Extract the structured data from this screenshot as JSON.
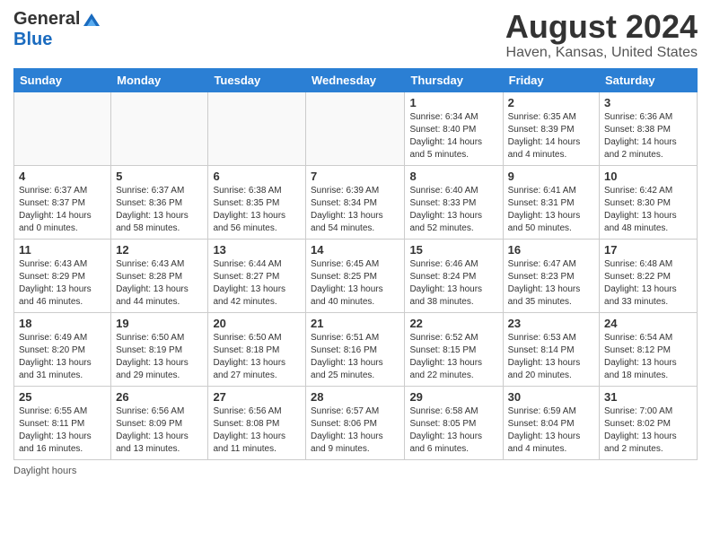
{
  "header": {
    "logo_general": "General",
    "logo_blue": "Blue",
    "month_title": "August 2024",
    "location": "Haven, Kansas, United States"
  },
  "days_of_week": [
    "Sunday",
    "Monday",
    "Tuesday",
    "Wednesday",
    "Thursday",
    "Friday",
    "Saturday"
  ],
  "weeks": [
    [
      {
        "day": "",
        "info": ""
      },
      {
        "day": "",
        "info": ""
      },
      {
        "day": "",
        "info": ""
      },
      {
        "day": "",
        "info": ""
      },
      {
        "day": "1",
        "info": "Sunrise: 6:34 AM\nSunset: 8:40 PM\nDaylight: 14 hours\nand 5 minutes."
      },
      {
        "day": "2",
        "info": "Sunrise: 6:35 AM\nSunset: 8:39 PM\nDaylight: 14 hours\nand 4 minutes."
      },
      {
        "day": "3",
        "info": "Sunrise: 6:36 AM\nSunset: 8:38 PM\nDaylight: 14 hours\nand 2 minutes."
      }
    ],
    [
      {
        "day": "4",
        "info": "Sunrise: 6:37 AM\nSunset: 8:37 PM\nDaylight: 14 hours\nand 0 minutes."
      },
      {
        "day": "5",
        "info": "Sunrise: 6:37 AM\nSunset: 8:36 PM\nDaylight: 13 hours\nand 58 minutes."
      },
      {
        "day": "6",
        "info": "Sunrise: 6:38 AM\nSunset: 8:35 PM\nDaylight: 13 hours\nand 56 minutes."
      },
      {
        "day": "7",
        "info": "Sunrise: 6:39 AM\nSunset: 8:34 PM\nDaylight: 13 hours\nand 54 minutes."
      },
      {
        "day": "8",
        "info": "Sunrise: 6:40 AM\nSunset: 8:33 PM\nDaylight: 13 hours\nand 52 minutes."
      },
      {
        "day": "9",
        "info": "Sunrise: 6:41 AM\nSunset: 8:31 PM\nDaylight: 13 hours\nand 50 minutes."
      },
      {
        "day": "10",
        "info": "Sunrise: 6:42 AM\nSunset: 8:30 PM\nDaylight: 13 hours\nand 48 minutes."
      }
    ],
    [
      {
        "day": "11",
        "info": "Sunrise: 6:43 AM\nSunset: 8:29 PM\nDaylight: 13 hours\nand 46 minutes."
      },
      {
        "day": "12",
        "info": "Sunrise: 6:43 AM\nSunset: 8:28 PM\nDaylight: 13 hours\nand 44 minutes."
      },
      {
        "day": "13",
        "info": "Sunrise: 6:44 AM\nSunset: 8:27 PM\nDaylight: 13 hours\nand 42 minutes."
      },
      {
        "day": "14",
        "info": "Sunrise: 6:45 AM\nSunset: 8:25 PM\nDaylight: 13 hours\nand 40 minutes."
      },
      {
        "day": "15",
        "info": "Sunrise: 6:46 AM\nSunset: 8:24 PM\nDaylight: 13 hours\nand 38 minutes."
      },
      {
        "day": "16",
        "info": "Sunrise: 6:47 AM\nSunset: 8:23 PM\nDaylight: 13 hours\nand 35 minutes."
      },
      {
        "day": "17",
        "info": "Sunrise: 6:48 AM\nSunset: 8:22 PM\nDaylight: 13 hours\nand 33 minutes."
      }
    ],
    [
      {
        "day": "18",
        "info": "Sunrise: 6:49 AM\nSunset: 8:20 PM\nDaylight: 13 hours\nand 31 minutes."
      },
      {
        "day": "19",
        "info": "Sunrise: 6:50 AM\nSunset: 8:19 PM\nDaylight: 13 hours\nand 29 minutes."
      },
      {
        "day": "20",
        "info": "Sunrise: 6:50 AM\nSunset: 8:18 PM\nDaylight: 13 hours\nand 27 minutes."
      },
      {
        "day": "21",
        "info": "Sunrise: 6:51 AM\nSunset: 8:16 PM\nDaylight: 13 hours\nand 25 minutes."
      },
      {
        "day": "22",
        "info": "Sunrise: 6:52 AM\nSunset: 8:15 PM\nDaylight: 13 hours\nand 22 minutes."
      },
      {
        "day": "23",
        "info": "Sunrise: 6:53 AM\nSunset: 8:14 PM\nDaylight: 13 hours\nand 20 minutes."
      },
      {
        "day": "24",
        "info": "Sunrise: 6:54 AM\nSunset: 8:12 PM\nDaylight: 13 hours\nand 18 minutes."
      }
    ],
    [
      {
        "day": "25",
        "info": "Sunrise: 6:55 AM\nSunset: 8:11 PM\nDaylight: 13 hours\nand 16 minutes."
      },
      {
        "day": "26",
        "info": "Sunrise: 6:56 AM\nSunset: 8:09 PM\nDaylight: 13 hours\nand 13 minutes."
      },
      {
        "day": "27",
        "info": "Sunrise: 6:56 AM\nSunset: 8:08 PM\nDaylight: 13 hours\nand 11 minutes."
      },
      {
        "day": "28",
        "info": "Sunrise: 6:57 AM\nSunset: 8:06 PM\nDaylight: 13 hours\nand 9 minutes."
      },
      {
        "day": "29",
        "info": "Sunrise: 6:58 AM\nSunset: 8:05 PM\nDaylight: 13 hours\nand 6 minutes."
      },
      {
        "day": "30",
        "info": "Sunrise: 6:59 AM\nSunset: 8:04 PM\nDaylight: 13 hours\nand 4 minutes."
      },
      {
        "day": "31",
        "info": "Sunrise: 7:00 AM\nSunset: 8:02 PM\nDaylight: 13 hours\nand 2 minutes."
      }
    ]
  ],
  "footer": {
    "note": "Daylight hours"
  }
}
